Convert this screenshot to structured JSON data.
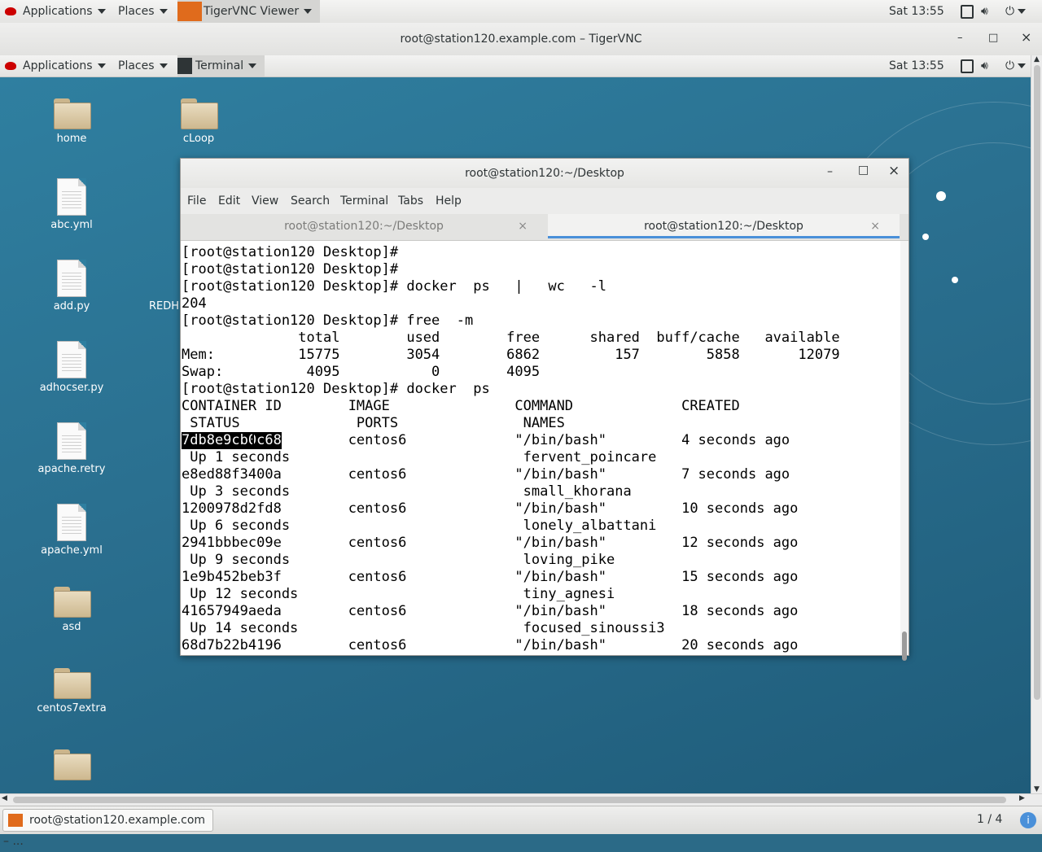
{
  "outer_top_bar": {
    "applications": "Applications",
    "places": "Places",
    "app_name": "TigerVNC Viewer",
    "clock": "Sat 13:55"
  },
  "vnc_window": {
    "title": "root@station120.example.com – TigerVNC",
    "minimize": "–",
    "maximize": "□",
    "close": "×"
  },
  "remote_top_bar": {
    "applications": "Applications",
    "places": "Places",
    "app_name": "Terminal",
    "clock": "Sat 13:55"
  },
  "desktop_icons": [
    {
      "label": "home",
      "type": "home-folder"
    },
    {
      "label": "cLoop",
      "type": "folder"
    },
    {
      "label": "abc.yml",
      "type": "file"
    },
    {
      "label": "add.py",
      "type": "file"
    },
    {
      "label": "adhocser.py",
      "type": "file"
    },
    {
      "label": "apache.retry",
      "type": "file"
    },
    {
      "label": "apache.yml",
      "type": "file"
    },
    {
      "label": "asd",
      "type": "folder"
    },
    {
      "label": "centos7extra",
      "type": "folder"
    },
    {
      "label": "",
      "type": "folder"
    }
  ],
  "desktop_partial_label": "REDH",
  "terminal": {
    "title": "root@station120:~/Desktop",
    "menu": [
      "File",
      "Edit",
      "View",
      "Search",
      "Terminal",
      "Tabs",
      "Help"
    ],
    "tabs": [
      {
        "label": "root@station120:~/Desktop",
        "active": false
      },
      {
        "label": "root@station120:~/Desktop",
        "active": true
      }
    ],
    "lines": [
      "[root@station120 Desktop]#",
      "[root@station120 Desktop]#",
      "[root@station120 Desktop]# docker  ps   |   wc   -l",
      "204",
      "[root@station120 Desktop]# free  -m",
      "              total        used        free      shared  buff/cache   available",
      "Mem:          15775        3054        6862         157        5858       12079",
      "Swap:          4095           0        4095",
      "[root@station120 Desktop]# docker  ps",
      "CONTAINER ID        IMAGE               COMMAND             CREATED",
      " STATUS              PORTS               NAMES",
      "7db8e9cb0c68        centos6             \"/bin/bash\"         4 seconds ago",
      " Up 1 seconds                            fervent_poincare",
      "e8ed88f3400a        centos6             \"/bin/bash\"         7 seconds ago",
      " Up 3 seconds                            small_khorana",
      "1200978d2fd8        centos6             \"/bin/bash\"         10 seconds ago",
      " Up 6 seconds                            lonely_albattani",
      "2941bbbec09e        centos6             \"/bin/bash\"         12 seconds ago",
      " Up 9 seconds                            loving_pike",
      "1e9b452beb3f        centos6             \"/bin/bash\"         15 seconds ago",
      " Up 12 seconds                           tiny_agnesi",
      "41657949aeda        centos6             \"/bin/bash\"         18 seconds ago",
      " Up 14 seconds                           focused_sinoussi3",
      "68d7b22b4196        centos6             \"/bin/bash\"         20 seconds ago"
    ],
    "selected_text": "7db8e9cb0c68"
  },
  "taskbar": {
    "task_label": "root@station120.example.com – ...",
    "workspace": "1 / 4"
  }
}
